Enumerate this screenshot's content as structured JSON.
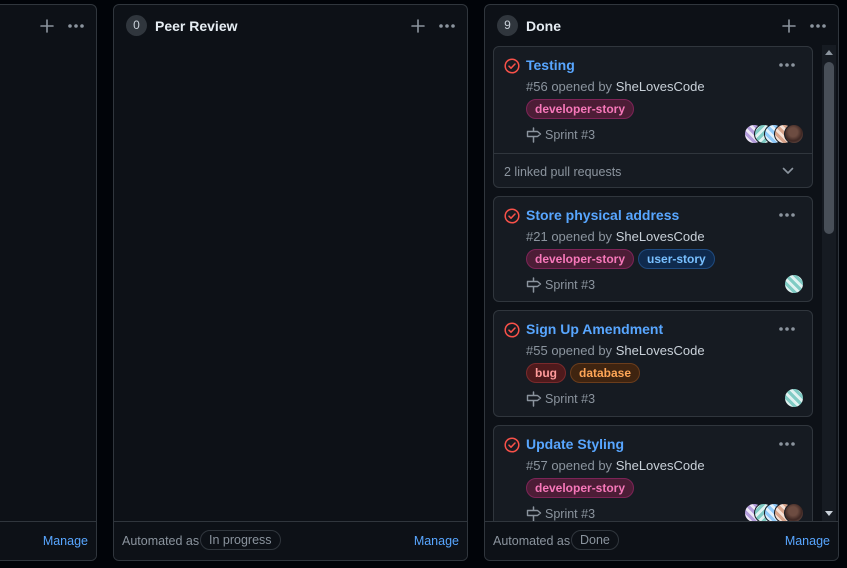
{
  "board": {
    "left_column": {
      "manage_label": "Manage"
    },
    "peer_review": {
      "count": "0",
      "title": "Peer Review",
      "automated_text": "Automated as",
      "automation_state": "In progress",
      "manage_label": "Manage"
    },
    "done": {
      "count": "9",
      "title": "Done",
      "automated_text": "Automated as",
      "automation_state": "Done",
      "manage_label": "Manage",
      "cards": [
        {
          "title": "Testing",
          "number": "#56",
          "opened_by": "opened by",
          "author": "SheLovesCode",
          "labels": [
            {
              "name": "developer-story",
              "color": "#f778ba"
            }
          ],
          "milestone": "Sprint #3",
          "linked_prs": "2 linked pull requests"
        },
        {
          "title": "Store physical address",
          "number": "#21",
          "opened_by": "opened by",
          "author": "SheLovesCode",
          "labels": [
            {
              "name": "developer-story",
              "color": "#f778ba"
            },
            {
              "name": "user-story",
              "color": "#79c0ff"
            }
          ],
          "milestone": "Sprint #3"
        },
        {
          "title": "Sign Up Amendment",
          "number": "#55",
          "opened_by": "opened by",
          "author": "SheLovesCode",
          "labels": [
            {
              "name": "bug",
              "color": "#ff9b9b"
            },
            {
              "name": "database",
              "color": "#ffa657"
            }
          ],
          "milestone": "Sprint #3"
        },
        {
          "title": "Update Styling",
          "number": "#57",
          "opened_by": "opened by",
          "author": "SheLovesCode",
          "labels": [
            {
              "name": "developer-story",
              "color": "#f778ba"
            }
          ],
          "milestone": "Sprint #3"
        }
      ]
    }
  },
  "icons": {
    "add": "plus-icon",
    "more": "kebab-horizontal-icon",
    "issue_closed": "issue-closed-icon",
    "milestone": "milestone-icon",
    "chevron": "chevron-down-icon"
  },
  "colors": {
    "background": "#010409",
    "column": "#0d1117",
    "card": "#161b22",
    "border": "#30363d",
    "link": "#58a6ff",
    "closed_issue": "#f85149",
    "muted_text": "#8b949e"
  }
}
